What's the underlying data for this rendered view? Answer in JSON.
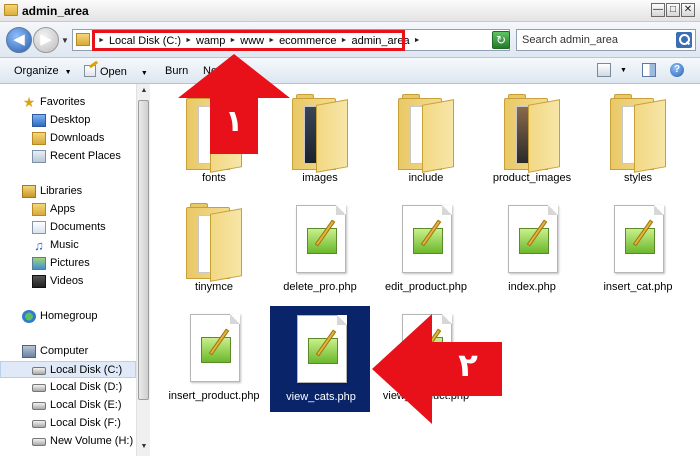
{
  "window": {
    "title": "admin_area",
    "controls": [
      "—",
      "□",
      "✕"
    ]
  },
  "address": {
    "crumbs": [
      "Local Disk (C:)",
      "wamp",
      "www",
      "ecommerce",
      "admin_area"
    ],
    "search_placeholder": "Search admin_area"
  },
  "toolbar": {
    "organize": "Organize",
    "open": "Open",
    "burn": "Burn",
    "new_folder_partial": "Ne"
  },
  "sidebar": {
    "favorites": {
      "label": "Favorites",
      "items": [
        "Desktop",
        "Downloads",
        "Recent Places"
      ]
    },
    "libraries": {
      "label": "Libraries",
      "items": [
        "Apps",
        "Documents",
        "Music",
        "Pictures",
        "Videos"
      ]
    },
    "homegroup": "Homegroup",
    "computer": {
      "label": "Computer",
      "items": [
        "Local Disk (C:)",
        "Local Disk (D:)",
        "Local Disk (E:)",
        "Local Disk (F:)",
        "New Volume (H:)"
      ],
      "selected_index": 0
    }
  },
  "files": [
    {
      "name": "fonts",
      "kind": "folder"
    },
    {
      "name": "images",
      "kind": "folder"
    },
    {
      "name": "include",
      "kind": "folder"
    },
    {
      "name": "product_images",
      "kind": "folder"
    },
    {
      "name": "styles",
      "kind": "folder"
    },
    {
      "name": "tinymce",
      "kind": "folder"
    },
    {
      "name": "delete_pro.php",
      "kind": "php"
    },
    {
      "name": "edit_product.php",
      "kind": "php"
    },
    {
      "name": "index.php",
      "kind": "php"
    },
    {
      "name": "insert_cat.php",
      "kind": "php"
    },
    {
      "name": "insert_product.php",
      "kind": "php"
    },
    {
      "name": "view_cats.php",
      "kind": "php",
      "selected": true
    },
    {
      "name": "view_product.php",
      "kind": "php"
    }
  ],
  "annotations": {
    "arrow1_label": "١",
    "arrow2_label": "٢",
    "color": "#e8111a"
  }
}
